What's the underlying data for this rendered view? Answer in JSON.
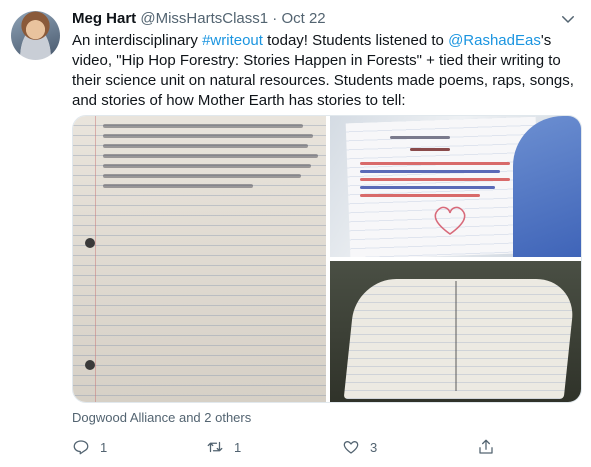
{
  "tweet": {
    "display_name": "Meg Hart",
    "handle": "@MissHartsClass1",
    "separator": "·",
    "date": "Oct 22",
    "text_parts": {
      "t1": "An interdisciplinary ",
      "hashtag": "#writeout",
      "t2": " today! Students listened to ",
      "mention": "@RashadEas",
      "t3": "'s video, \"Hip Hop Forestry: Stories Happen in Forests\" + tied their writing to their science unit on natural resources. Students made poems, raps, songs, and stories of how Mother Earth has stories to tell:"
    },
    "liked_by": "Dogwood Alliance and 2 others",
    "actions": {
      "reply_count": "1",
      "retweet_count": "1",
      "like_count": "3"
    }
  },
  "icons": {
    "caret": "chevron-down-icon",
    "reply": "reply-icon",
    "retweet": "retweet-icon",
    "like": "heart-icon",
    "share": "share-icon"
  },
  "colors": {
    "link": "#1b95e0",
    "secondary_text": "#536471",
    "primary_text": "#0f1419"
  }
}
